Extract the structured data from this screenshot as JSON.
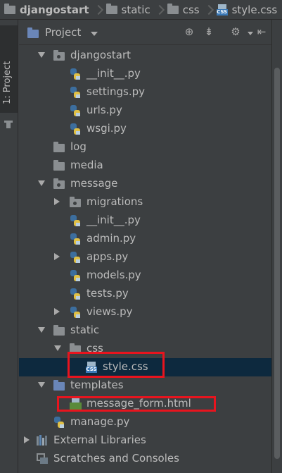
{
  "breadcrumb": {
    "items": [
      {
        "label": "djangostart",
        "icon": "folder-icon"
      },
      {
        "label": "static",
        "icon": "folder-icon"
      },
      {
        "label": "css",
        "icon": "folder-icon"
      },
      {
        "label": "style.css",
        "icon": "css-file-icon"
      }
    ]
  },
  "tool_strip": {
    "tab_label": "1: Project"
  },
  "panel": {
    "title": "Project",
    "toolbar": [
      "locate-icon",
      "collapse-all-icon",
      "gear-icon",
      "hide-icon"
    ]
  },
  "tree": [
    {
      "label": "djangostart",
      "icon": "package-folder-icon",
      "expand": "expanded",
      "level": 1
    },
    {
      "label": "__init__.py",
      "icon": "python-file-icon",
      "expand": "none",
      "level": 2
    },
    {
      "label": "settings.py",
      "icon": "python-file-icon",
      "expand": "none",
      "level": 2
    },
    {
      "label": "urls.py",
      "icon": "python-file-icon",
      "expand": "none",
      "level": 2
    },
    {
      "label": "wsgi.py",
      "icon": "python-file-icon",
      "expand": "none",
      "level": 2
    },
    {
      "label": "log",
      "icon": "folder-icon",
      "expand": "none",
      "level": 1
    },
    {
      "label": "media",
      "icon": "folder-icon",
      "expand": "none",
      "level": 1
    },
    {
      "label": "message",
      "icon": "package-folder-icon",
      "expand": "expanded",
      "level": 1
    },
    {
      "label": "migrations",
      "icon": "package-folder-icon",
      "expand": "collapsed",
      "level": 2
    },
    {
      "label": "__init__.py",
      "icon": "python-file-icon",
      "expand": "none",
      "level": 2
    },
    {
      "label": "admin.py",
      "icon": "python-file-icon",
      "expand": "none",
      "level": 2
    },
    {
      "label": "apps.py",
      "icon": "python-file-icon",
      "expand": "collapsed",
      "level": 2
    },
    {
      "label": "models.py",
      "icon": "python-file-icon",
      "expand": "none",
      "level": 2
    },
    {
      "label": "tests.py",
      "icon": "python-file-icon",
      "expand": "none",
      "level": 2
    },
    {
      "label": "views.py",
      "icon": "python-file-icon",
      "expand": "collapsed",
      "level": 2
    },
    {
      "label": "static",
      "icon": "folder-icon",
      "expand": "expanded",
      "level": 1
    },
    {
      "label": "css",
      "icon": "folder-icon",
      "expand": "expanded",
      "level": 2
    },
    {
      "label": "style.css",
      "icon": "css-file-icon",
      "expand": "none",
      "level": 3,
      "selected": true,
      "highlighted": true
    },
    {
      "label": "templates",
      "icon": "templates-folder-icon",
      "expand": "expanded",
      "level": 1
    },
    {
      "label": "message_form.html",
      "icon": "html-file-icon",
      "expand": "none",
      "level": 2,
      "highlighted": true
    },
    {
      "label": "manage.py",
      "icon": "python-file-icon",
      "expand": "none",
      "level": 1
    },
    {
      "label": "External Libraries",
      "icon": "libraries-icon",
      "expand": "collapsed",
      "level": 0
    },
    {
      "label": "Scratches and Consoles",
      "icon": "scratches-icon",
      "expand": "none",
      "level": 0
    }
  ],
  "colors": {
    "background": "#3c3f41",
    "selection": "#0d293e",
    "highlight_box": "#e8141e",
    "text": "#bbbbbb"
  }
}
